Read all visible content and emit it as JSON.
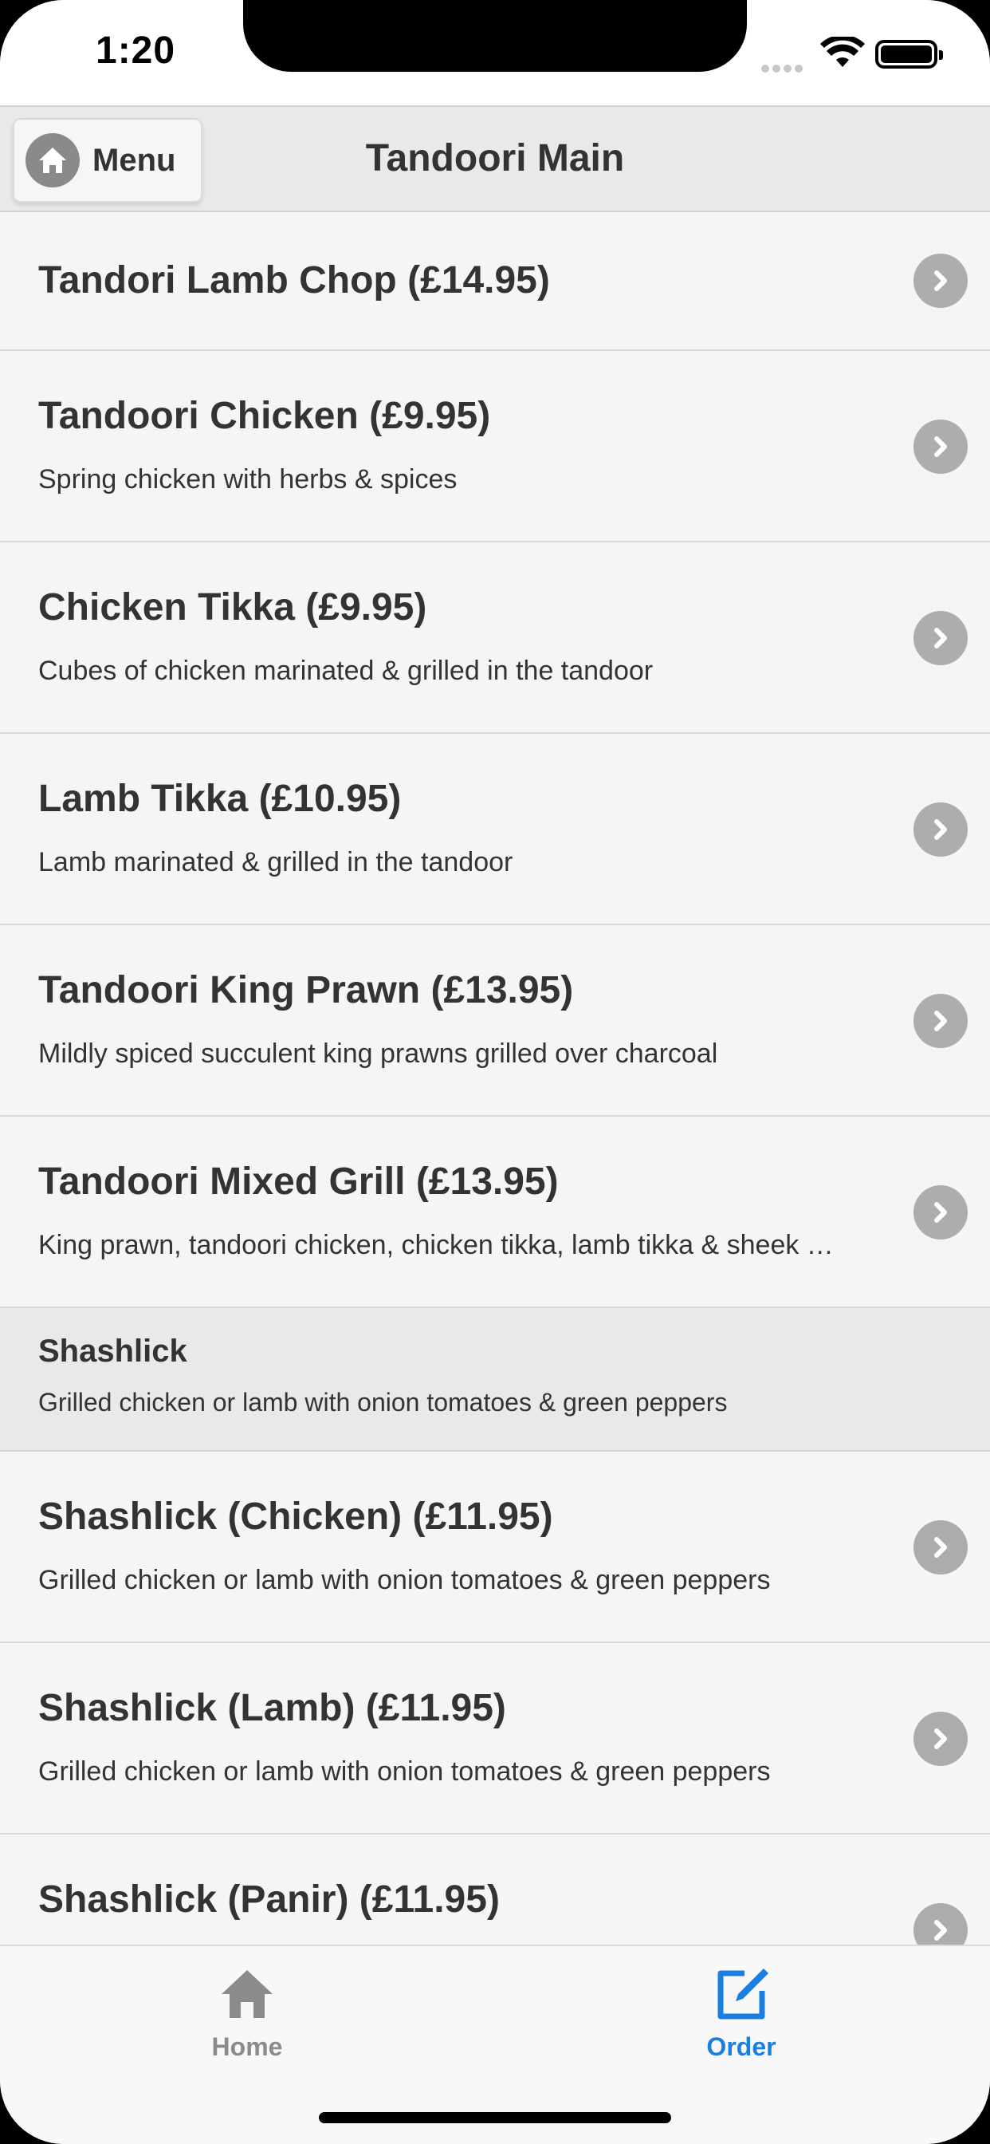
{
  "status_bar": {
    "time": "1:20"
  },
  "header": {
    "menu_label": "Menu",
    "title": "Tandoori Main"
  },
  "items": [
    {
      "title": "Tandori Lamb Chop (£14.95)",
      "description": ""
    },
    {
      "title": "Tandoori Chicken (£9.95)",
      "description": "Spring chicken with herbs & spices"
    },
    {
      "title": "Chicken Tikka (£9.95)",
      "description": "Cubes of chicken marinated & grilled in the tandoor"
    },
    {
      "title": "Lamb Tikka (£10.95)",
      "description": "Lamb marinated & grilled in the tandoor"
    },
    {
      "title": "Tandoori King Prawn (£13.95)",
      "description": "Mildly spiced succulent king prawns grilled over charcoal"
    },
    {
      "title": "Tandoori Mixed Grill (£13.95)",
      "description": "King prawn, tandoori chicken, chicken tikka, lamb tikka & sheek …"
    }
  ],
  "section": {
    "title": "Shashlick",
    "description": "Grilled chicken or lamb with onion tomatoes & green peppers"
  },
  "section_items": [
    {
      "title": "Shashlick (Chicken) (£11.95)",
      "description": "Grilled chicken or lamb with onion tomatoes & green peppers"
    },
    {
      "title": "Shashlick (Lamb) (£11.95)",
      "description": "Grilled chicken or lamb with onion tomatoes & green peppers"
    },
    {
      "title": "Shashlick (Panir) (£11.95)",
      "description": ""
    }
  ],
  "tabbar": {
    "home_label": "Home",
    "order_label": "Order",
    "active_color": "#1a7fe0",
    "inactive_color": "#8b8b8b"
  },
  "icons": {
    "menu_button": "home-icon",
    "row": "chevron-right-icon",
    "home_tab": "home-icon",
    "order_tab": "edit-icon"
  }
}
